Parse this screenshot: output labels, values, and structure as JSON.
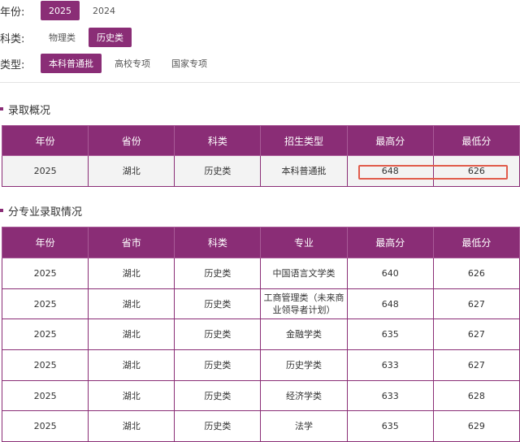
{
  "filters": {
    "year": {
      "label": "年份:",
      "options": [
        "2025",
        "2024"
      ],
      "active": 0
    },
    "category": {
      "label": "科类:",
      "options": [
        "物理类",
        "历史类"
      ],
      "active": 1
    },
    "type": {
      "label": "类型:",
      "options": [
        "本科普通批",
        "高校专项",
        "国家专项"
      ],
      "active": 0
    }
  },
  "overview": {
    "title": "录取概况",
    "headers": [
      "年份",
      "省份",
      "科类",
      "招生类型",
      "最高分",
      "最低分"
    ],
    "rows": [
      [
        "2025",
        "湖北",
        "历史类",
        "本科普通批",
        "648",
        "626"
      ]
    ]
  },
  "majors": {
    "title": "分专业录取情况",
    "headers": [
      "年份",
      "省市",
      "科类",
      "专业",
      "最高分",
      "最低分"
    ],
    "rows": [
      [
        "2025",
        "湖北",
        "历史类",
        "中国语言文学类",
        "640",
        "626"
      ],
      [
        "2025",
        "湖北",
        "历史类",
        "工商管理类（未来商业领导者计划）",
        "648",
        "627"
      ],
      [
        "2025",
        "湖北",
        "历史类",
        "金融学类",
        "635",
        "627"
      ],
      [
        "2025",
        "湖北",
        "历史类",
        "历史学类",
        "633",
        "627"
      ],
      [
        "2025",
        "湖北",
        "历史类",
        "经济学类",
        "633",
        "628"
      ],
      [
        "2025",
        "湖北",
        "历史类",
        "法学",
        "635",
        "629"
      ]
    ]
  },
  "colors": {
    "accent": "#8a2d76",
    "highlight": "#e15b4b"
  }
}
